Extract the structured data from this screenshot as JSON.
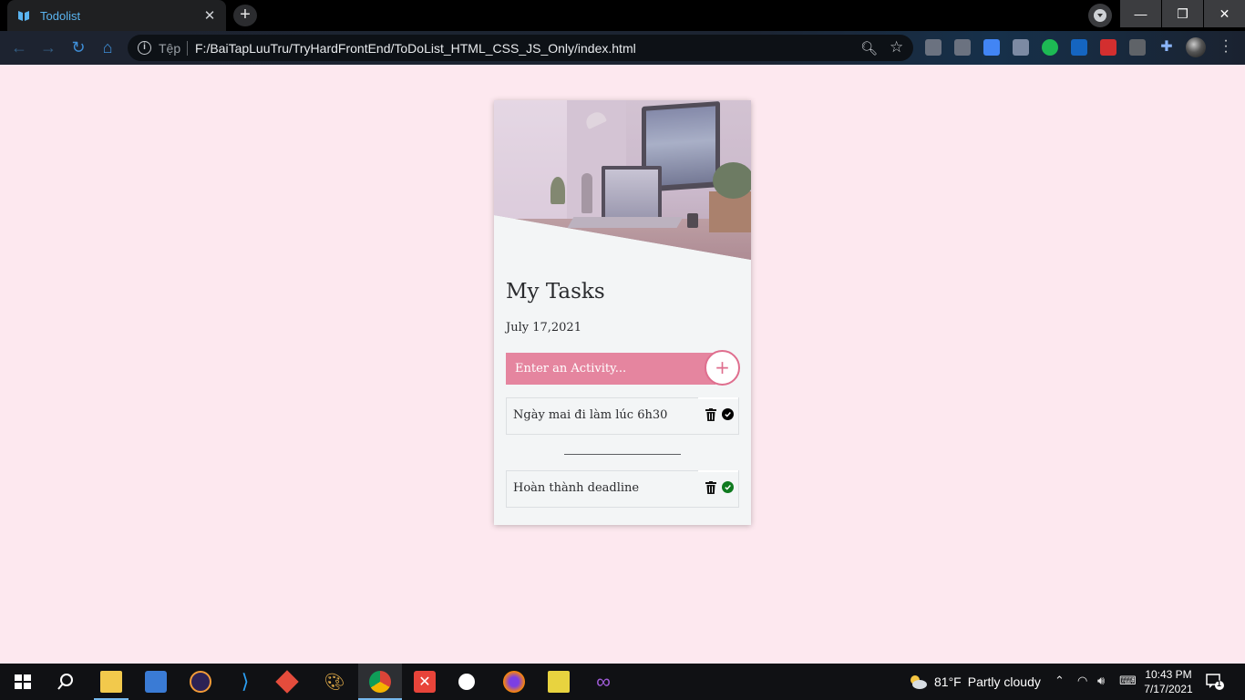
{
  "browser": {
    "tab_title": "Todolist",
    "tab_close": "✕",
    "new_tab": "+",
    "omnibox_label": "Tệp",
    "url": "F:/BaiTapLuuTru/TryHardFrontEnd/ToDoList_HTML_CSS_JS_Only/index.html",
    "window_controls": {
      "minimize": "—",
      "restore": "❐",
      "close": "✕"
    }
  },
  "app": {
    "title": "My Tasks",
    "date": "July 17,2021",
    "input_placeholder": "Enter an Activity...",
    "add_button": "+",
    "tasks": [
      {
        "text": "Ngày mai đi làm lúc 6h30",
        "done": false,
        "check_color": "#000000"
      },
      {
        "text": "Hoàn thành deadline",
        "done": true,
        "check_color": "#0f7a1f"
      }
    ],
    "colors": {
      "accent": "#e5859f",
      "background": "#fde8ef",
      "card": "#f3f5f6"
    }
  },
  "taskbar": {
    "weather_temp": "81°F",
    "weather_desc": "Partly cloudy",
    "time": "10:43 PM",
    "date": "7/17/2021",
    "notification_count": "1"
  }
}
